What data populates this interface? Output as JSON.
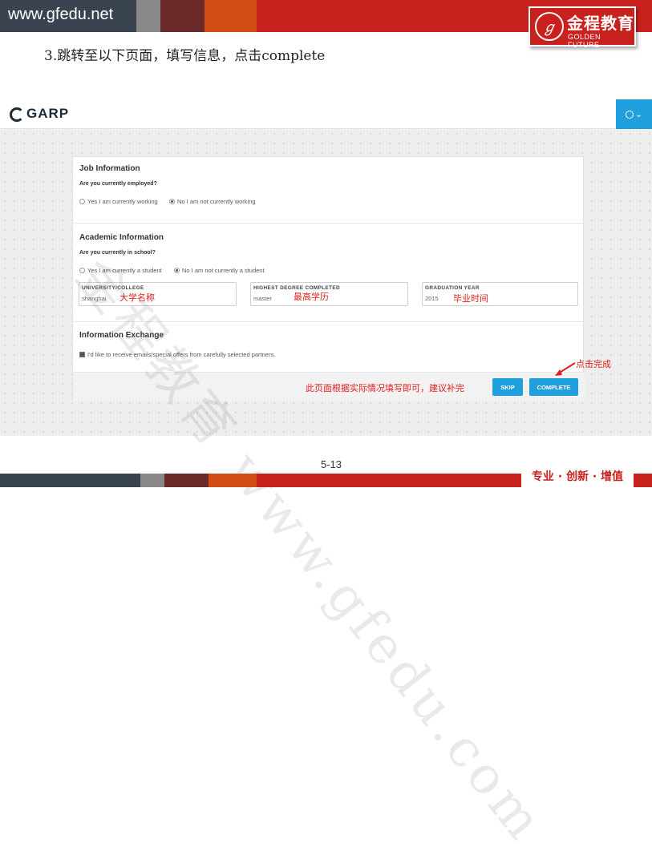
{
  "slide": {
    "site_url": "www.gfedu.net",
    "brand_cn": "金程教育",
    "brand_en": "GOLDEN FUTURE",
    "step_instruction": "3.跳转至以下页面，填写信息，点击complete",
    "page_number": "5-13",
    "slogan": "专业 · 创新 · 增值",
    "watermark": "金程教育 www.gfedu.com"
  },
  "garp": {
    "logo_text": "GARP",
    "user_menu_caret": "⌄"
  },
  "form": {
    "job": {
      "title": "Job Information",
      "question": "Are you currently employed?",
      "options": [
        "Yes I am currently working",
        "No I am not currently working"
      ],
      "selected": 1
    },
    "academic": {
      "title": "Academic Information",
      "question": "Are you currently in school?",
      "options": [
        "Yes I am currently a student",
        "No I am not currently a student"
      ],
      "selected": 1,
      "fields": [
        {
          "label": "UNIVERSITY/COLLEGE",
          "value": "shanghai",
          "annotation": "大学名称"
        },
        {
          "label": "HIGHEST DEGREE COMPLETED",
          "value": "master",
          "annotation": "最高学历"
        },
        {
          "label": "GRADUATION YEAR",
          "value": "2015",
          "annotation": "毕业时间"
        }
      ]
    },
    "exchange": {
      "title": "Information Exchange",
      "checkbox_label": "I'd like to receive emails/special offers from carefully selected partners.",
      "checked": true
    },
    "footer": {
      "note": "此页面根据实际情况填写即可，建议补完",
      "skip_label": "SKIP",
      "complete_label": "COMPLETE",
      "complete_annotation": "点击完成"
    }
  },
  "colors": {
    "brand_red": "#c9211e",
    "header_dark": "#3a4450",
    "button_blue": "#1f9fde",
    "annotation_red": "#e0201c"
  }
}
